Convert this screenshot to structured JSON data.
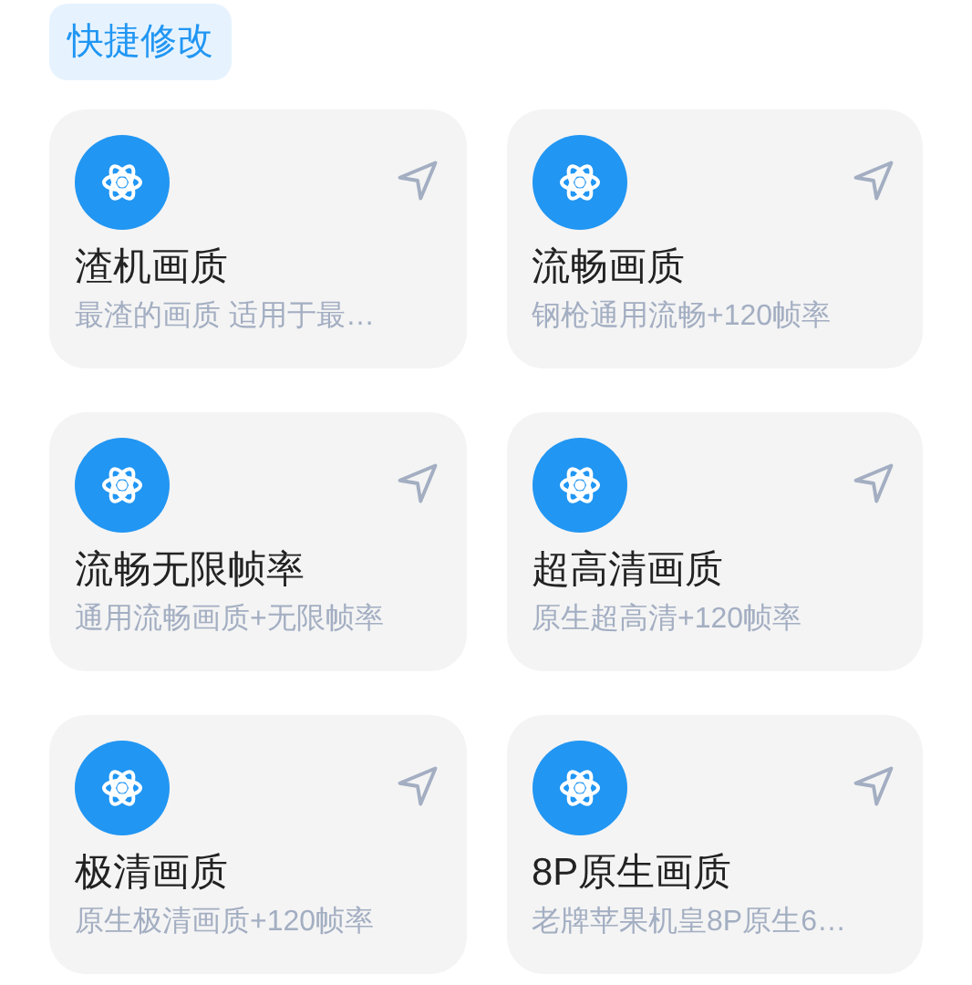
{
  "header": {
    "label": "快捷修改"
  },
  "presets": [
    {
      "title": "渣机画质",
      "description": "最渣的画质 适用于最…"
    },
    {
      "title": "流畅画质",
      "description": "钢枪通用流畅+120帧率"
    },
    {
      "title": "流畅无限帧率",
      "description": "通用流畅画质+无限帧率"
    },
    {
      "title": "超高清画质",
      "description": "原生超高清+120帧率"
    },
    {
      "title": "极清画质",
      "description": "原生极清画质+120帧率"
    },
    {
      "title": "8P原生画质",
      "description": "老牌苹果机皇8P原生6…"
    }
  ]
}
